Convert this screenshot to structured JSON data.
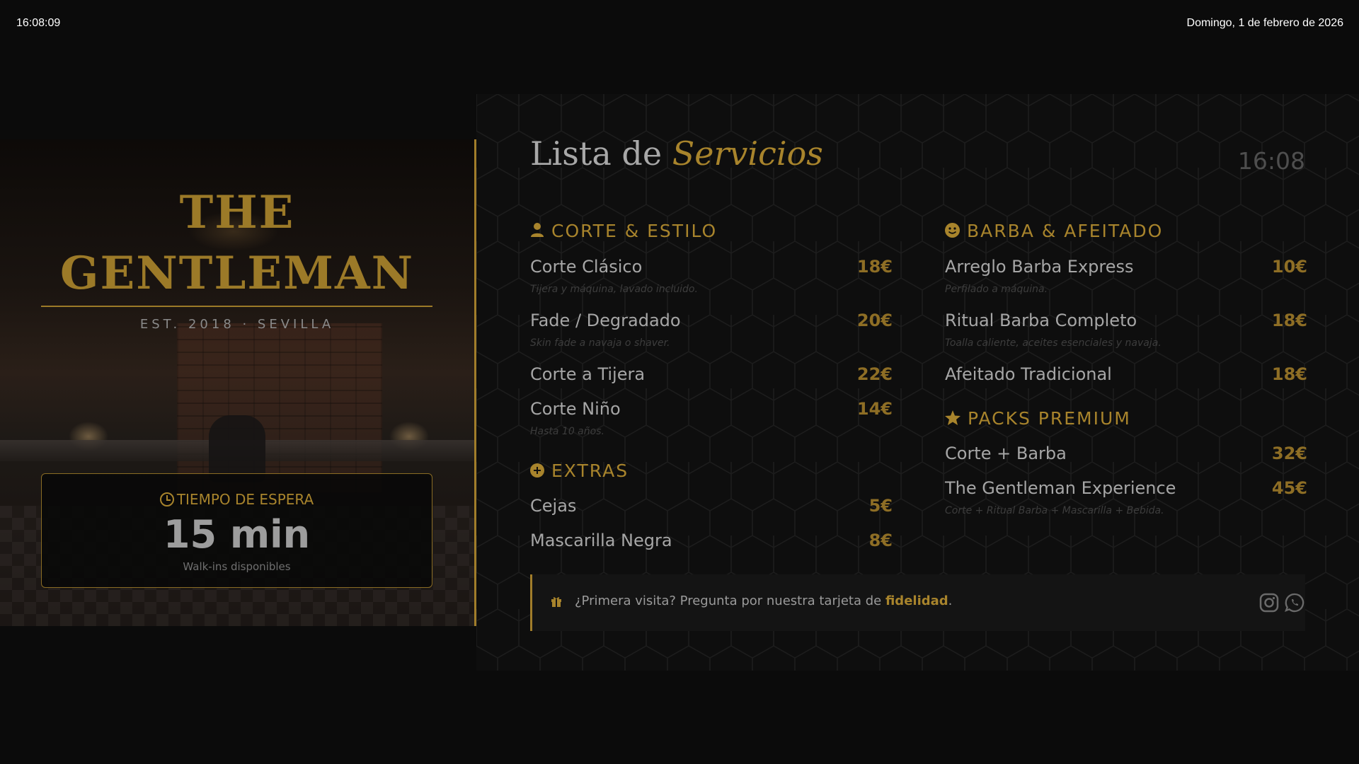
{
  "topbar": {
    "time": "16:08:09",
    "date": "Domingo, 1 de febrero de 2026"
  },
  "brand": {
    "line1": "THE",
    "line2": "GENTLEMAN",
    "subtitle": "EST. 2018 · SEVILLA"
  },
  "wait": {
    "title": "TIEMPO DE ESPERA",
    "value": "15 min",
    "note": "Walk-ins disponibles"
  },
  "header": {
    "title_plain": "Lista de",
    "title_accent": "Servicios",
    "time": "16:08"
  },
  "sections": {
    "corte": {
      "title": "CORTE & ESTILO",
      "icon": "user-icon",
      "items": [
        {
          "name": "Corte Clásico",
          "price": "18€",
          "desc": "Tijera y máquina, lavado incluido."
        },
        {
          "name": "Fade / Degradado",
          "price": "20€",
          "desc": "Skin fade a navaja o shaver."
        },
        {
          "name": "Corte a Tijera",
          "price": "22€",
          "desc": ""
        },
        {
          "name": "Corte Niño",
          "price": "14€",
          "desc": "Hasta 10 años."
        }
      ]
    },
    "extras": {
      "title": "EXTRAS",
      "icon": "plus-circle-icon",
      "items": [
        {
          "name": "Cejas",
          "price": "5€"
        },
        {
          "name": "Mascarilla Negra",
          "price": "8€"
        }
      ]
    },
    "barba": {
      "title": "BARBA & AFEITADO",
      "icon": "smile-icon",
      "items": [
        {
          "name": "Arreglo Barba Express",
          "price": "10€",
          "desc": "Perfilado a máquina."
        },
        {
          "name": "Ritual Barba Completo",
          "price": "18€",
          "desc": "Toalla caliente, aceites esenciales y navaja."
        },
        {
          "name": "Afeitado Tradicional",
          "price": "18€",
          "desc": ""
        }
      ]
    },
    "packs": {
      "title": "PACKS PREMIUM",
      "icon": "star-icon",
      "items": [
        {
          "name": "Corte + Barba",
          "price": "32€",
          "desc": ""
        },
        {
          "name": "The Gentleman Experience",
          "price": "45€",
          "desc": "Corte + Ritual Barba + Mascarilla + Bebida."
        }
      ]
    }
  },
  "footer": {
    "text": "¿Primera visita? Pregunta por nuestra tarjeta de",
    "highlight": "fidelidad",
    "end": ".",
    "icons": [
      "gift-icon",
      "instagram-icon",
      "whatsapp-icon"
    ]
  },
  "colors": {
    "accent": "#a8842c",
    "background": "#0b0b0b"
  }
}
